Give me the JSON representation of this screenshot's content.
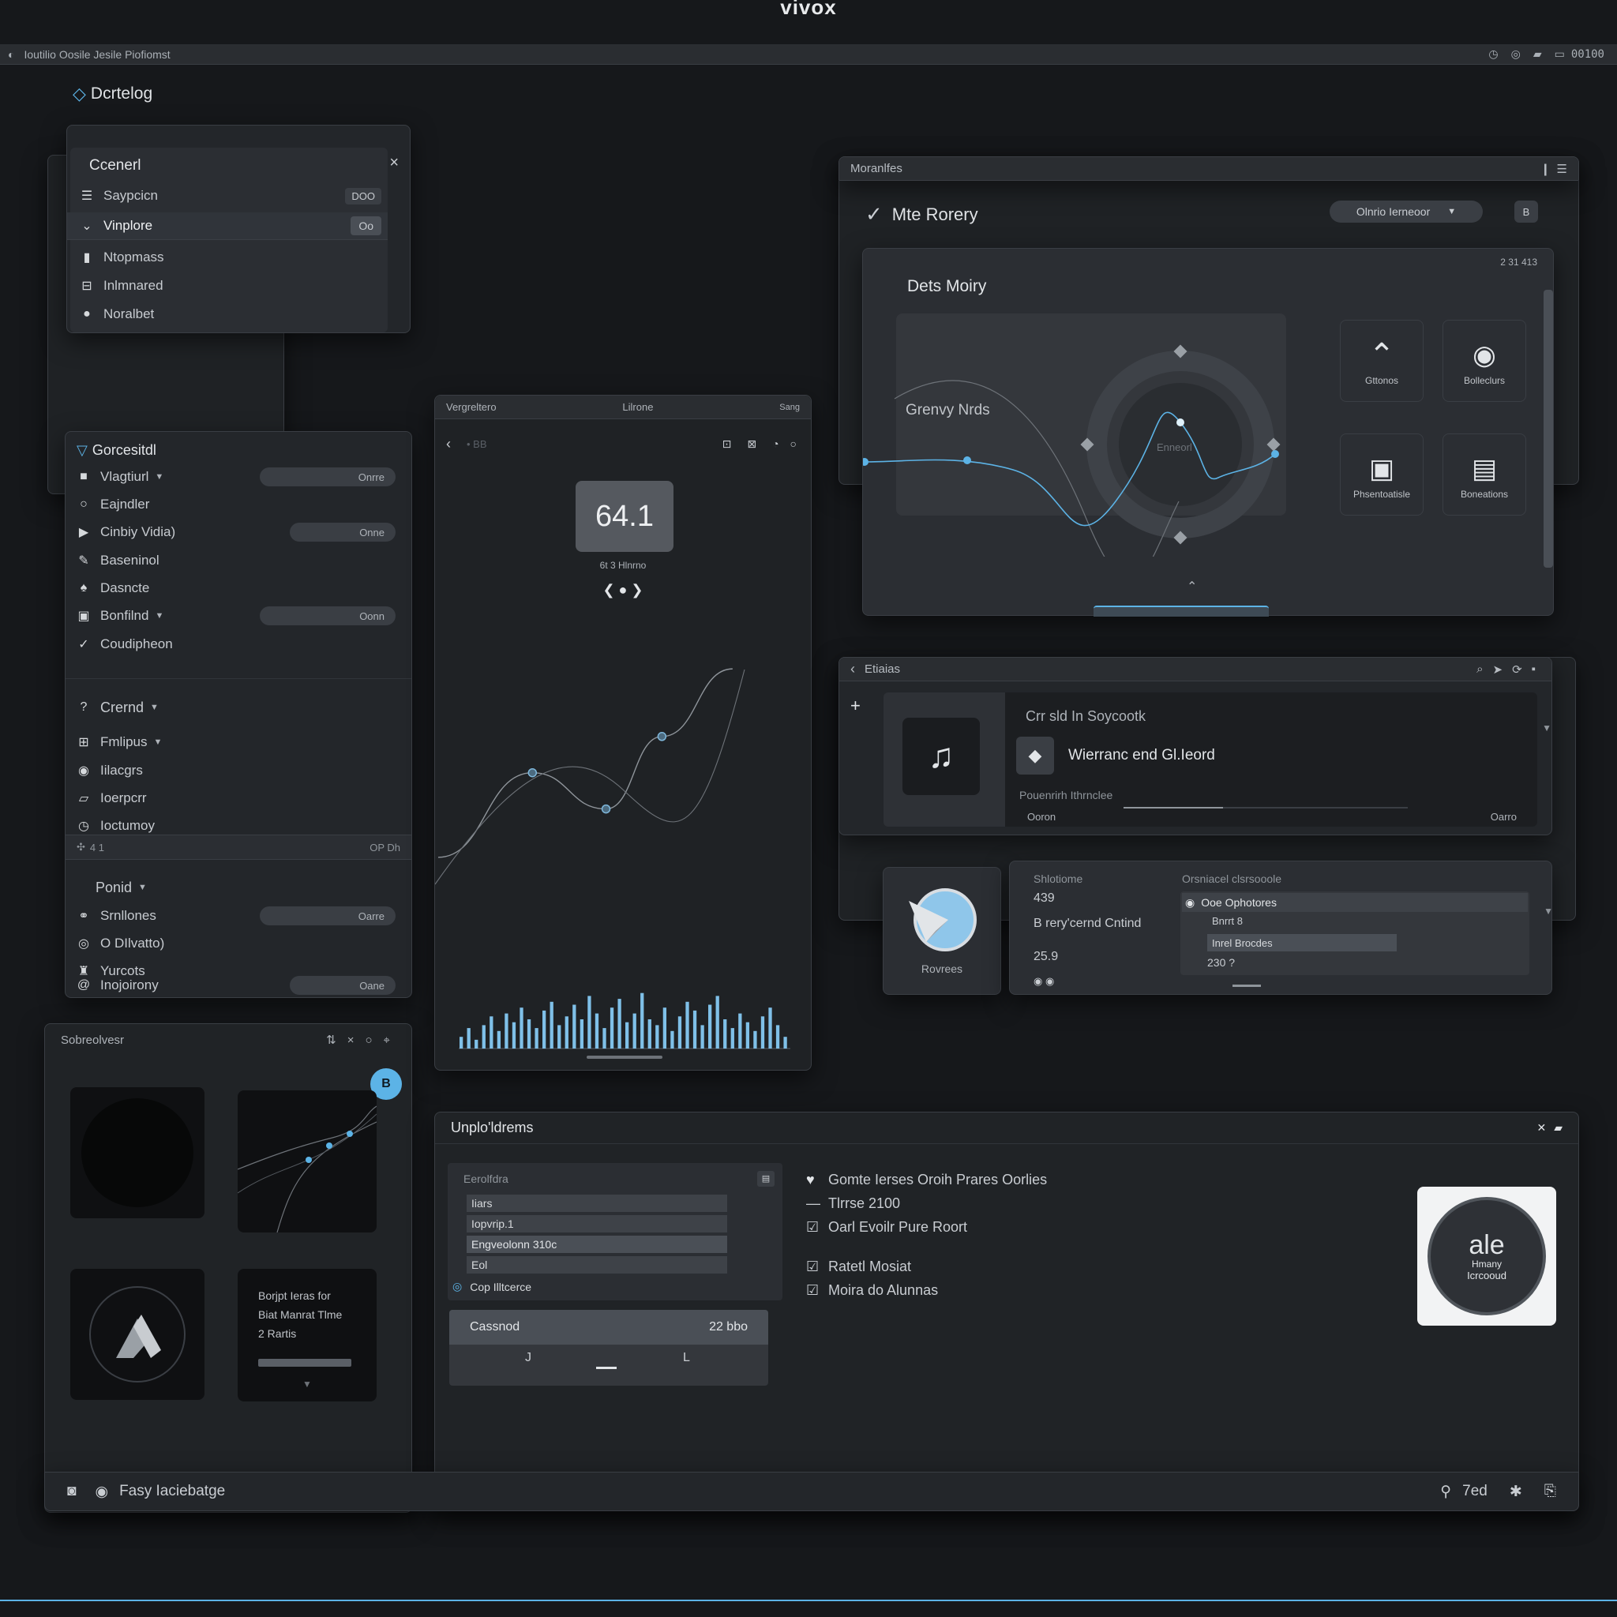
{
  "window": {
    "title": "vivox",
    "tabs_bar": "Ioutilio Oosile Jesile Piofiomst",
    "tray_text": "00100"
  },
  "catalog": {
    "label": "Dcrtelog"
  },
  "general_panel": {
    "title": "Ccenerl",
    "items": [
      {
        "label": "Saypcicn",
        "icon": "list-icon",
        "badge": "DOO"
      },
      {
        "label": "Vinplore",
        "icon": "bird-icon",
        "badge": "Oo"
      },
      {
        "label": "Ntopmass",
        "icon": "book-icon"
      },
      {
        "label": "Inlmnared",
        "icon": "grid-icon"
      },
      {
        "label": "Noralbet",
        "icon": "circle-icon"
      }
    ]
  },
  "settings_panel": {
    "title": "Gorcesitdl",
    "items": [
      {
        "label": "Vlagtiurl",
        "icon": "square-icon",
        "caret": true,
        "pill": "Onrre"
      },
      {
        "label": "Eajndler",
        "icon": "ring-icon"
      },
      {
        "label": "Cinbiy Vidia)",
        "icon": "play-icon",
        "pill": "Onne"
      },
      {
        "label": "Baseninol",
        "icon": "brush-icon"
      },
      {
        "label": "Dasncte",
        "icon": "leaf-icon"
      },
      {
        "label": "Bonfilnd",
        "icon": "save-icon",
        "caret": true,
        "pill": "Oonn"
      },
      {
        "label": "Coudipheon",
        "icon": "pen-icon"
      }
    ],
    "group_title": "Crernd",
    "group_items": [
      {
        "label": "Fmlipus",
        "icon": "box-icon",
        "caret": true
      },
      {
        "label": "Iilacgrs",
        "icon": "disc-icon"
      },
      {
        "label": "Ioerpcrr",
        "icon": "frame-icon"
      },
      {
        "label": "Ioctumoy",
        "icon": "clock-icon"
      }
    ],
    "footer_left": "4 1",
    "footer_right": "OP Dh",
    "group2_title": "Ponid",
    "group2_items": [
      {
        "label": "Srnllones",
        "icon": "link-icon",
        "pill": "Oarre"
      },
      {
        "label": "O DIlvatto)",
        "icon": "bubble-icon"
      },
      {
        "label": "Yurcots",
        "icon": "stamp-icon"
      },
      {
        "label": "Inojoirony",
        "icon": "at-icon",
        "pill": "Oane"
      }
    ]
  },
  "visualizer_panel": {
    "title": "Sobreolvesr",
    "badge": "B",
    "card_text": [
      "Borjpt Ieras for",
      "Biat Manrat Tlme",
      "2 Rartis"
    ]
  },
  "phone": {
    "title_left": "Vergreltero",
    "title_center": "Lilrone",
    "title_right": "Sang",
    "nav_hint": "• BB",
    "reading": "64.1",
    "reading_caption": "6t 3  Hlnrno"
  },
  "monitor_panel": {
    "title": "Moranlfes",
    "heading": "Mte Rorery",
    "dropdown": "Olnrio Ierneoor",
    "small_button": "B",
    "inner_title": "Dets Moiry",
    "inner_meta": "2  31 413",
    "chart_label": "Grenvy Nrds",
    "dial_label": "Enneorl",
    "tiles": [
      {
        "label": "Gttonos",
        "icon": "caret-up-icon"
      },
      {
        "label": "Bolleclurs",
        "icon": "target-icon"
      },
      {
        "label": "Phsentoatisle",
        "icon": "image-icon"
      },
      {
        "label": "Boneations",
        "icon": "document-icon"
      }
    ]
  },
  "media_panel": {
    "title": "Etiaias",
    "subtitle": "Crr sld In Soycootk",
    "track": "Wierranc end Gl.Ieord",
    "meta": "Pouenrirh Ithrnclee",
    "time_left": "Ooron",
    "time_right": "Oarro",
    "progress": 0.35
  },
  "stats_panel": {
    "app_label": "Rovrees",
    "col1_title": "Shlotiome",
    "col1_values": [
      "439",
      "B rery'cernd Cntind",
      "25.9"
    ],
    "col2_title": "Orsniacel clsrsooole",
    "col2_rows": [
      "Ooe Ophotores",
      "Bnrrt 8",
      "Inrel Brocdes",
      "230 ?"
    ]
  },
  "uploads_panel": {
    "title": "Unplo'ldrems",
    "list_title": "Eerolfdra",
    "list_items": [
      "Iiars",
      "Iopvrip.1",
      "Engveolonn 310c",
      "Eol"
    ],
    "toggle_label": "Cop Illtcerce",
    "slider_label": "Cassnod",
    "slider_value": "22 bbo",
    "slider_marks": [
      "J",
      "L"
    ],
    "notes": [
      {
        "icon": "pin-icon",
        "text": "Gomte Ierses Oroih Prares Oorlies"
      },
      {
        "icon": "dash-icon",
        "text": "Tlrrse 2100"
      },
      {
        "icon": "checkbox-icon",
        "text": "Oarl Evoilr Pure Roort"
      },
      {
        "icon": "checkbox-icon",
        "text": "Ratetl Mosiat"
      },
      {
        "icon": "checkbox-icon",
        "text": "Moira do Alunnas"
      }
    ],
    "badge_big": "ale",
    "badge_line1": "Hmany",
    "badge_line2": "Icrcooud"
  },
  "status_bar": {
    "label": "Fasy Iaciebatge",
    "right_text": "7ed"
  },
  "colors": {
    "accent": "#5cb3e6",
    "panel": "#23262a",
    "background": "#16181b"
  },
  "charts": {
    "phone_curve_points": [
      [
        0,
        0.8
      ],
      [
        0.32,
        0.45
      ],
      [
        0.57,
        0.6
      ],
      [
        0.76,
        0.3
      ],
      [
        1,
        0.02
      ]
    ],
    "phone_bars": [
      0.2,
      0.35,
      0.15,
      0.4,
      0.55,
      0.3,
      0.6,
      0.45,
      0.7,
      0.5,
      0.35,
      0.65,
      0.8,
      0.4,
      0.55,
      0.75,
      0.5,
      0.9,
      0.6,
      0.35,
      0.7,
      0.85,
      0.45,
      0.6,
      0.95,
      0.5,
      0.4,
      0.7,
      0.3,
      0.55,
      0.8,
      0.65,
      0.4,
      0.75,
      0.9,
      0.5,
      0.35,
      0.6,
      0.45,
      0.3,
      0.55,
      0.7,
      0.4,
      0.2
    ]
  }
}
